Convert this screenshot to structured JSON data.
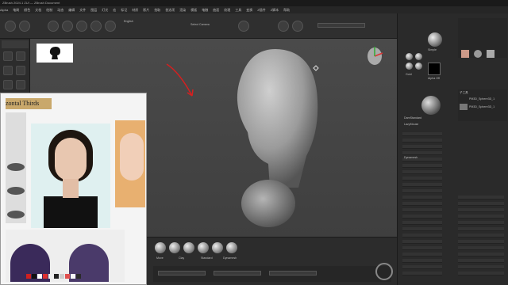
{
  "titlebar": {
    "text": "ZBrush 2024.1 ZUI — ZBrush Document"
  },
  "menu": {
    "items": [
      "Alpha",
      "笔刷",
      "颜色",
      "文档",
      "绘制",
      "动态",
      "编辑",
      "文件",
      "图层",
      "灯光",
      "宏",
      "标记",
      "材质",
      "影片",
      "拾取",
      "首选项",
      "渲染",
      "模板",
      "笔触",
      "曲面",
      "纹理",
      "工具",
      "变换",
      "Z插件",
      "Z脚本",
      "帮助"
    ]
  },
  "topbar": {
    "font_label": "English",
    "select_camera": "Select Camera",
    "lightbox": "LightBox"
  },
  "reference": {
    "heading": "zontal Thirds",
    "colors": [
      "#d02020",
      "#111111",
      "#ffffff",
      "#e03030",
      "#f0f0f0",
      "#222222",
      "#cccccc",
      "#e05050",
      "#f6f6f6",
      "#2a2a2a"
    ]
  },
  "rightpanel": {
    "labels": [
      "Simple",
      "Gold",
      "Alpha Off",
      "DamStandard",
      "Dynamesh",
      "LazyMouse"
    ],
    "subtool_title": "子工具",
    "subtools": [
      "PM3D_Sphere3D_1",
      "PM3D_Sphere3D_1"
    ]
  },
  "bottombar": {
    "labels": [
      "Move",
      "Clay",
      "Standard",
      "Dynamesh"
    ]
  }
}
